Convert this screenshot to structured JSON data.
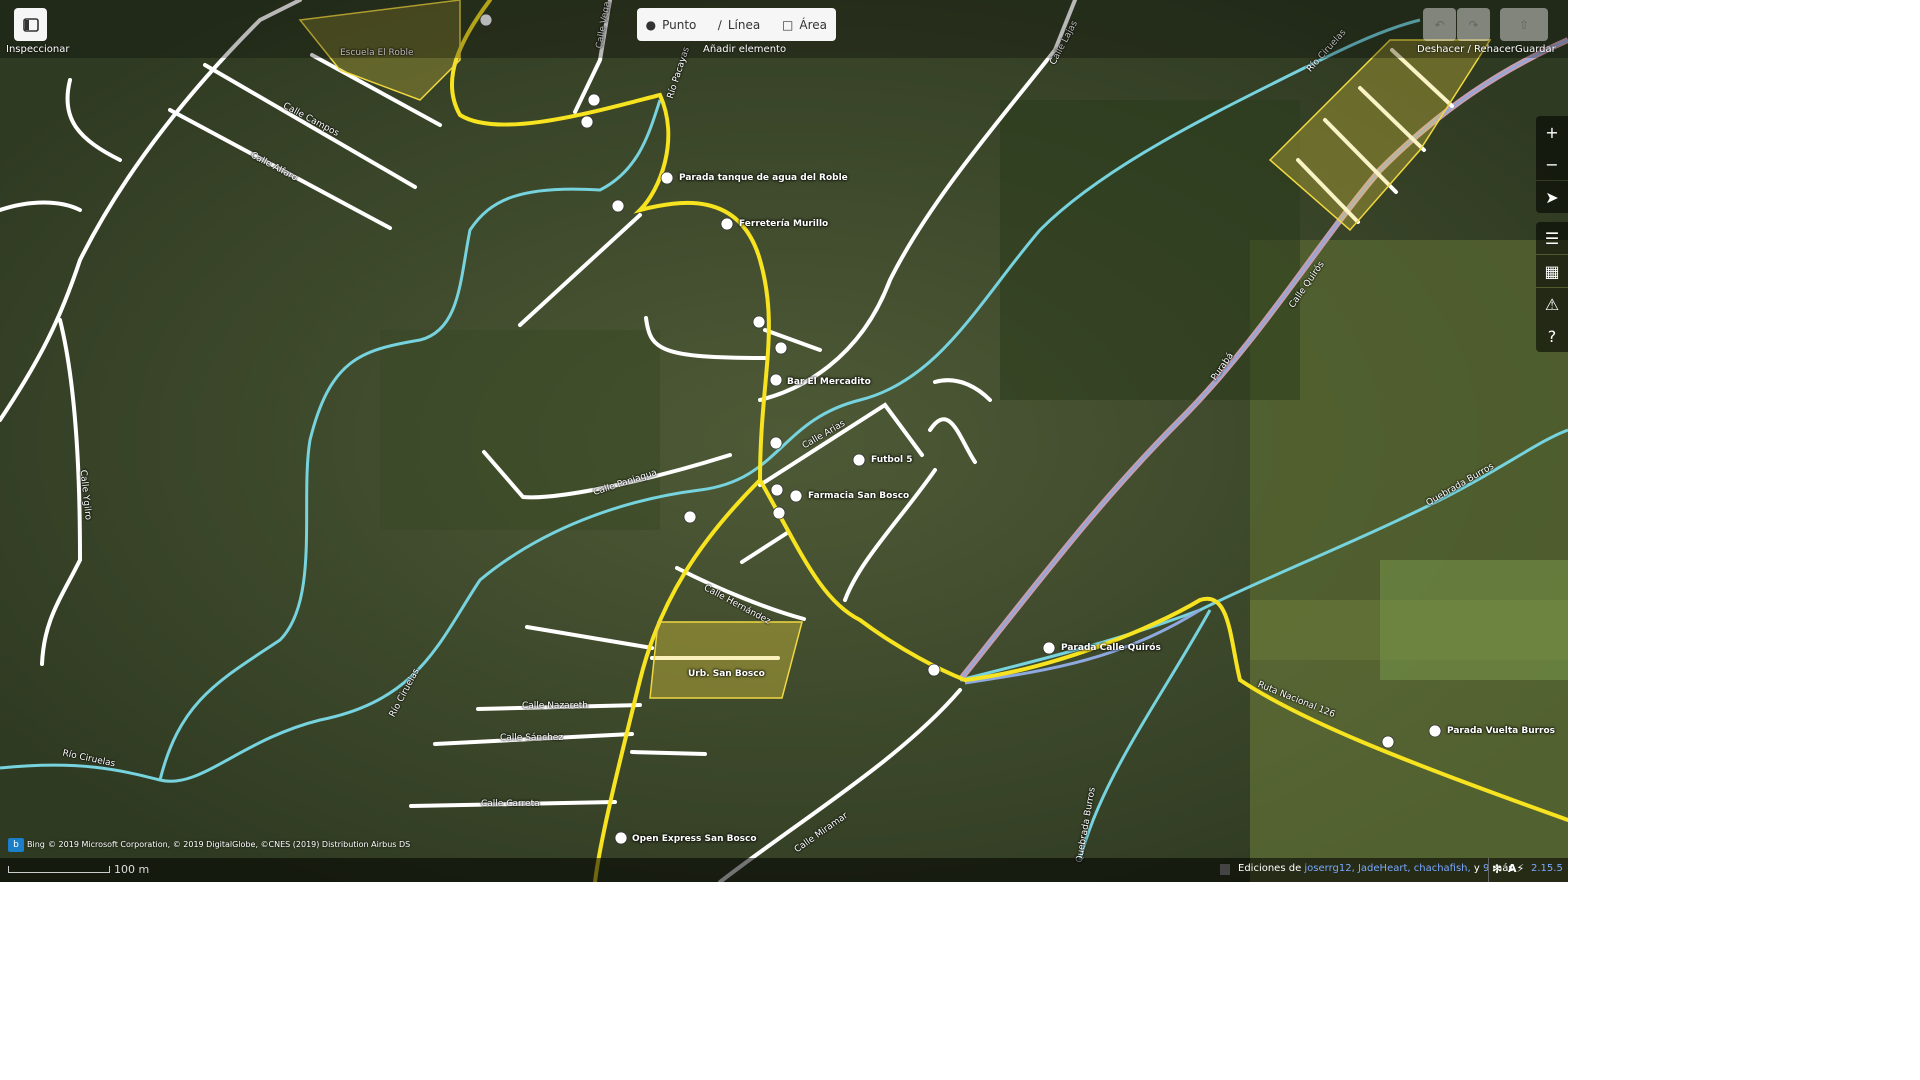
{
  "toolbar": {
    "inspect_label": "Inspeccionar",
    "add_point": "Punto",
    "add_line": "Línea",
    "add_area": "Área",
    "add_caption": "Añadir elemento",
    "undo_redo_caption": "Deshacer / Rehacer",
    "save_caption": "Guardar"
  },
  "map_labels": {
    "escuela": "Escuela El Roble",
    "calle_campos": "Calle Campos",
    "calle_alfaro": "Calle Alfaro",
    "calle_vega": "Calle Vega",
    "rio_pacayas": "Río Pacayas",
    "calle_lajas": "Calle Lajas",
    "rio_ciruelas_top": "Río Ciruelas",
    "parada_tanque": "Parada tanque de agua del Roble",
    "ferreteria": "Ferretería Murillo",
    "bar": "Bar El Mercadito",
    "calle_arias": "Calle Arias",
    "futbol": "Futbol 5",
    "farmacia": "Farmacia San Bosco",
    "calle_paniagua": "Calle Paniagua",
    "calle_yglesias": "Calle Ygilro",
    "calle_hernandez": "Calle Hernández",
    "urb_san_bosco": "Urb. San Bosco",
    "calle_nazareth": "Calle Nazareth",
    "calle_sanchez": "Calle Sánchez",
    "calle_carreta": "Calle Carreta",
    "rio_ciruelas_left": "Río Ciruelas",
    "rio_ciruelas_mid": "Río Ciruelas",
    "open_express": "Open Express San Bosco",
    "calle_miramar": "Calle Miramar",
    "parada_quiros": "Parada Calle Quirós",
    "ruta_126": "Ruta Nacional 126",
    "parada_burros": "Parada Vuelta Burros",
    "quebrada_burros_r": "Quebrada Burros",
    "quebrada_burros_b": "Quebrada Burros",
    "calle_quiros": "Calle Quirós",
    "purabi": "Purabá"
  },
  "attribution": {
    "bing": "Bing",
    "text": "© 2019 Microsoft Corporation, © 2019 DigitalGlobe, ©CNES (2019) Distribution Airbus DS"
  },
  "scale": "100 m",
  "edits": {
    "prefix": "Ediciones de",
    "users": "joserrg12, JadeHeart, chachafish,",
    "suffix_y": "y",
    "more_count": "9",
    "suffix_more": "más"
  },
  "version": "2.15.5",
  "colors": {
    "primary_road": "#f7e31f",
    "residential": "#ffffff",
    "river": "#77d3de",
    "trunk": "#c89dad",
    "area_fill": "#f0d840"
  }
}
